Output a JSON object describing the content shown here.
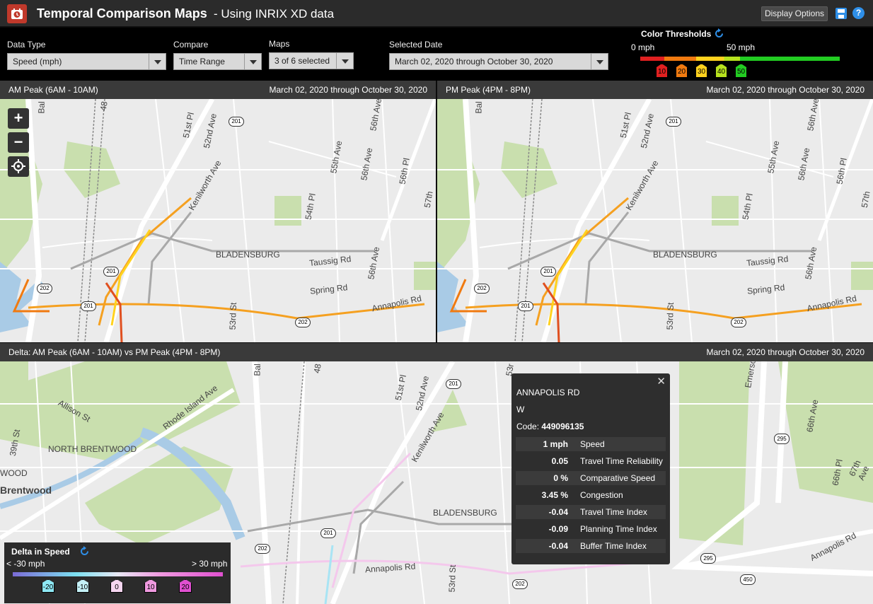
{
  "header": {
    "title": "Temporal Comparison Maps",
    "subtitle": "- Using INRIX XD data",
    "display_options": "Display Options"
  },
  "controls": {
    "data_type": {
      "label": "Data Type",
      "value": "Speed (mph)"
    },
    "compare": {
      "label": "Compare",
      "value": "Time Range"
    },
    "maps": {
      "label": "Maps",
      "value": "3 of 6 selected"
    },
    "selected_date": {
      "label": "Selected Date",
      "value": "March 02, 2020 through October 30, 2020"
    }
  },
  "thresholds": {
    "title": "Color Thresholds",
    "min": "0 mph",
    "max": "50 mph",
    "markers": [
      "10",
      "20",
      "30",
      "40",
      "50"
    ],
    "colors": [
      "#e02020",
      "#f07a10",
      "#ffd21e",
      "#b7e21e",
      "#22cc22"
    ]
  },
  "panels": {
    "am": {
      "title": "AM Peak (6AM - 10AM)",
      "date": "March 02, 2020 through October 30, 2020"
    },
    "pm": {
      "title": "PM Peak (4PM - 8PM)",
      "date": "March 02, 2020 through October 30, 2020"
    },
    "delta": {
      "title": "Delta: AM Peak (6AM - 10AM) vs PM Peak (4PM - 8PM)",
      "date": "March 02, 2020 through October 30, 2020"
    }
  },
  "map_controls": {
    "zoom_in": "+",
    "zoom_out": "−"
  },
  "map_labels": {
    "bladensburg": "BLADENSBURG",
    "taussig": "Taussig Rd",
    "spring": "Spring Rd",
    "annapolis": "Annapolis Rd",
    "kenilworth": "Kenilworth Ave",
    "s51": "51st Pl",
    "s52": "52nd Ave",
    "s53": "53rd St",
    "s53_top": "53r",
    "s55": "55th Ave",
    "s56": "56th Ave",
    "s56pl": "56th Pl",
    "s54pl": "54th Pl",
    "s57": "57th",
    "s48": "48",
    "bal": "Bal",
    "north_brentwood": "NORTH BRENTWOOD",
    "brentwood": "Brentwood",
    "wood": "WOOD",
    "allison": "Allison St",
    "s39": "39th St",
    "rhode_island": "Rhode Island Ave",
    "emerson": "Emerso",
    "s66": "66th Ave",
    "s66pl": "66th Pl",
    "s67": "67th Ave",
    "shield_201": "201",
    "shield_202": "202",
    "shield_295": "295",
    "shield_450": "450"
  },
  "popup": {
    "road": "ANNAPOLIS RD",
    "direction": "W",
    "code_label": "Code:",
    "code": "449096135",
    "rows": [
      {
        "value": "1 mph",
        "label": "Speed"
      },
      {
        "value": "0.05",
        "label": "Travel Time Reliability"
      },
      {
        "value": "0 %",
        "label": "Comparative Speed"
      },
      {
        "value": "3.45 %",
        "label": "Congestion"
      },
      {
        "value": "-0.04",
        "label": "Travel Time Index"
      },
      {
        "value": "-0.09",
        "label": "Planning Time Index"
      },
      {
        "value": "-0.04",
        "label": "Buffer Time Index"
      }
    ],
    "close": "✕"
  },
  "delta_legend": {
    "title": "Delta in Speed",
    "min": "< -30 mph",
    "max": "> 30 mph",
    "markers": [
      "-20",
      "-10",
      "0",
      "10",
      "20"
    ],
    "colors": [
      "#8ee8f4",
      "#c4f0f6",
      "#f6d6f0",
      "#f09ae0",
      "#e050d0"
    ]
  }
}
